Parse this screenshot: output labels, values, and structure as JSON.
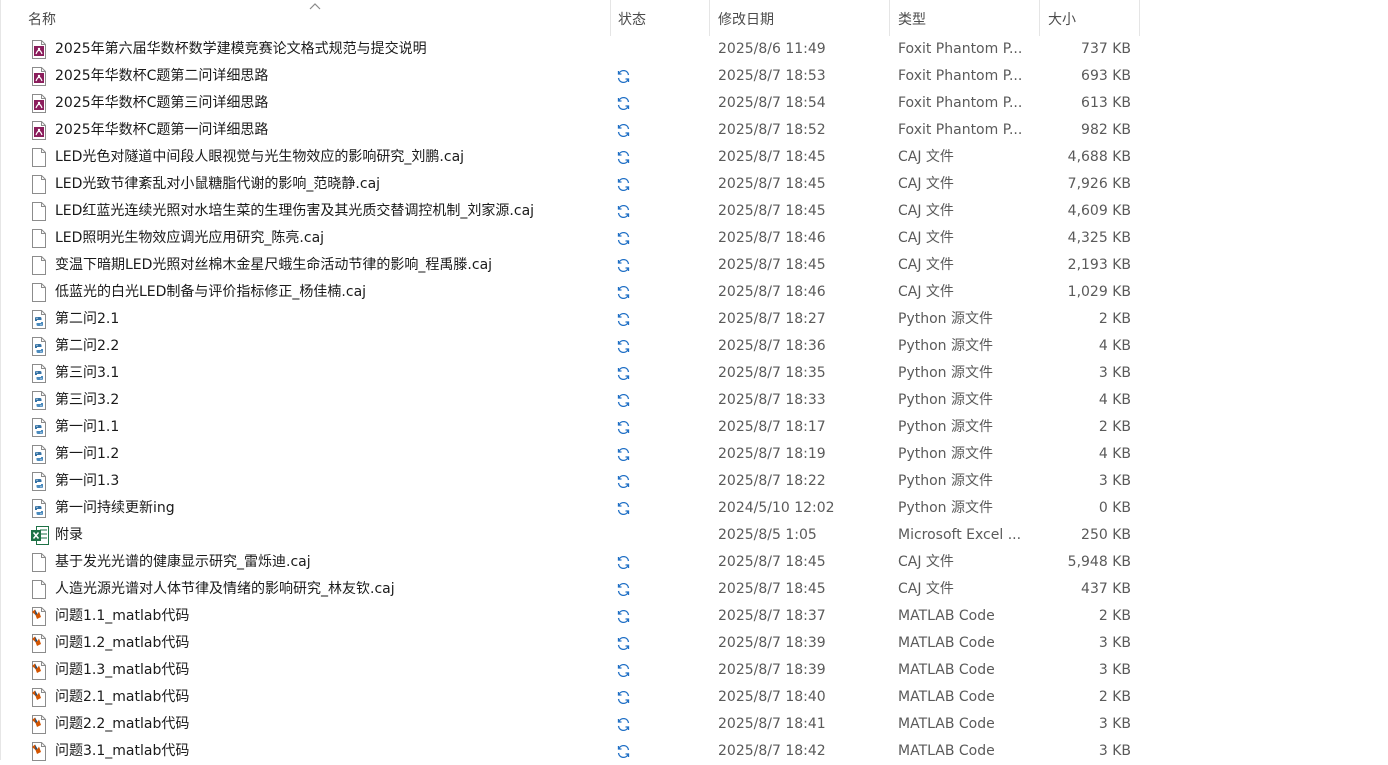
{
  "header": {
    "name": "名称",
    "status": "状态",
    "date": "修改日期",
    "type": "类型",
    "size": "大小"
  },
  "colors": {
    "sync": "#1f6fc5",
    "pdf": "#8b1e5c",
    "excel": "#1e7145",
    "matlab": "#d35400"
  },
  "files": [
    {
      "name": "2025年第六届华数杯数学建模竞赛论文格式规范与提交说明",
      "icon": "pdf-icon",
      "sync": false,
      "date": "2025/8/6 11:49",
      "type": "Foxit Phantom P...",
      "size": "737 KB"
    },
    {
      "name": "2025年华数杯C题第二问详细思路",
      "icon": "pdf-icon",
      "sync": true,
      "date": "2025/8/7 18:53",
      "type": "Foxit Phantom P...",
      "size": "693 KB"
    },
    {
      "name": "2025年华数杯C题第三问详细思路",
      "icon": "pdf-icon",
      "sync": true,
      "date": "2025/8/7 18:54",
      "type": "Foxit Phantom P...",
      "size": "613 KB"
    },
    {
      "name": "2025年华数杯C题第一问详细思路",
      "icon": "pdf-icon",
      "sync": true,
      "date": "2025/8/7 18:52",
      "type": "Foxit Phantom P...",
      "size": "982 KB"
    },
    {
      "name": "LED光色对隧道中间段人眼视觉与光生物效应的影响研究_刘鹏.caj",
      "icon": "blank-file-icon",
      "sync": true,
      "date": "2025/8/7 18:45",
      "type": "CAJ 文件",
      "size": "4,688 KB"
    },
    {
      "name": "LED光致节律紊乱对小鼠糖脂代谢的影响_范晓静.caj",
      "icon": "blank-file-icon",
      "sync": true,
      "date": "2025/8/7 18:45",
      "type": "CAJ 文件",
      "size": "7,926 KB"
    },
    {
      "name": "LED红蓝光连续光照对水培生菜的生理伤害及其光质交替调控机制_刘家源.caj",
      "icon": "blank-file-icon",
      "sync": true,
      "date": "2025/8/7 18:45",
      "type": "CAJ 文件",
      "size": "4,609 KB"
    },
    {
      "name": "LED照明光生物效应调光应用研究_陈亮.caj",
      "icon": "blank-file-icon",
      "sync": true,
      "date": "2025/8/7 18:46",
      "type": "CAJ 文件",
      "size": "4,325 KB"
    },
    {
      "name": "变温下暗期LED光照对丝棉木金星尺蛾生命活动节律的影响_程禹滕.caj",
      "icon": "blank-file-icon",
      "sync": true,
      "date": "2025/8/7 18:45",
      "type": "CAJ 文件",
      "size": "2,193 KB"
    },
    {
      "name": "低蓝光的白光LED制备与评价指标修正_杨佳楠.caj",
      "icon": "blank-file-icon",
      "sync": true,
      "date": "2025/8/7 18:46",
      "type": "CAJ 文件",
      "size": "1,029 KB"
    },
    {
      "name": "第二问2.1",
      "icon": "python-file-icon",
      "sync": true,
      "date": "2025/8/7 18:27",
      "type": "Python 源文件",
      "size": "2 KB"
    },
    {
      "name": "第二问2.2",
      "icon": "python-file-icon",
      "sync": true,
      "date": "2025/8/7 18:36",
      "type": "Python 源文件",
      "size": "4 KB"
    },
    {
      "name": "第三问3.1",
      "icon": "python-file-icon",
      "sync": true,
      "date": "2025/8/7 18:35",
      "type": "Python 源文件",
      "size": "3 KB"
    },
    {
      "name": "第三问3.2",
      "icon": "python-file-icon",
      "sync": true,
      "date": "2025/8/7 18:33",
      "type": "Python 源文件",
      "size": "4 KB"
    },
    {
      "name": "第一问1.1",
      "icon": "python-file-icon",
      "sync": true,
      "date": "2025/8/7 18:17",
      "type": "Python 源文件",
      "size": "2 KB"
    },
    {
      "name": "第一问1.2",
      "icon": "python-file-icon",
      "sync": true,
      "date": "2025/8/7 18:19",
      "type": "Python 源文件",
      "size": "4 KB"
    },
    {
      "name": "第一问1.3",
      "icon": "python-file-icon",
      "sync": true,
      "date": "2025/8/7 18:22",
      "type": "Python 源文件",
      "size": "3 KB"
    },
    {
      "name": "第一问持续更新ing",
      "icon": "python-file-icon",
      "sync": true,
      "date": "2024/5/10 12:02",
      "type": "Python 源文件",
      "size": "0 KB"
    },
    {
      "name": "附录",
      "icon": "excel-icon",
      "sync": false,
      "date": "2025/8/5 1:05",
      "type": "Microsoft Excel ...",
      "size": "250 KB"
    },
    {
      "name": "基于发光光谱的健康显示研究_雷烁迪.caj",
      "icon": "blank-file-icon",
      "sync": true,
      "date": "2025/8/7 18:45",
      "type": "CAJ 文件",
      "size": "5,948 KB"
    },
    {
      "name": "人造光源光谱对人体节律及情绪的影响研究_林友钦.caj",
      "icon": "blank-file-icon",
      "sync": true,
      "date": "2025/8/7 18:45",
      "type": "CAJ 文件",
      "size": "437 KB"
    },
    {
      "name": "问题1.1_matlab代码",
      "icon": "matlab-file-icon",
      "sync": true,
      "date": "2025/8/7 18:37",
      "type": "MATLAB Code",
      "size": "2 KB"
    },
    {
      "name": "问题1.2_matlab代码",
      "icon": "matlab-file-icon",
      "sync": true,
      "date": "2025/8/7 18:39",
      "type": "MATLAB Code",
      "size": "3 KB"
    },
    {
      "name": "问题1.3_matlab代码",
      "icon": "matlab-file-icon",
      "sync": true,
      "date": "2025/8/7 18:39",
      "type": "MATLAB Code",
      "size": "3 KB"
    },
    {
      "name": "问题2.1_matlab代码",
      "icon": "matlab-file-icon",
      "sync": true,
      "date": "2025/8/7 18:40",
      "type": "MATLAB Code",
      "size": "2 KB"
    },
    {
      "name": "问题2.2_matlab代码",
      "icon": "matlab-file-icon",
      "sync": true,
      "date": "2025/8/7 18:41",
      "type": "MATLAB Code",
      "size": "3 KB"
    },
    {
      "name": "问题3.1_matlab代码",
      "icon": "matlab-file-icon",
      "sync": true,
      "date": "2025/8/7 18:42",
      "type": "MATLAB Code",
      "size": "3 KB"
    }
  ]
}
